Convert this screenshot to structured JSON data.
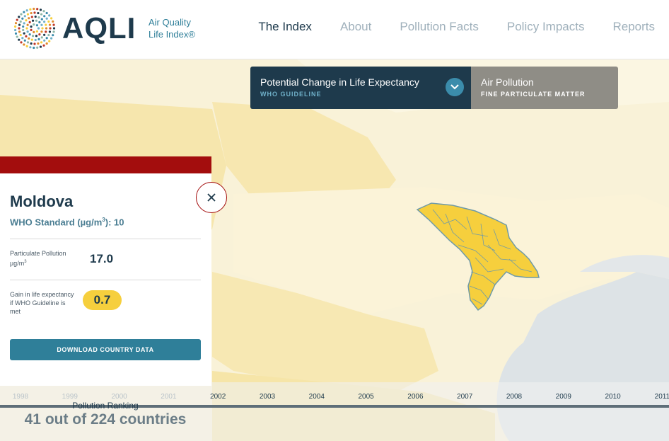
{
  "logo": {
    "name": "AQLI",
    "subtitle_line1": "Air Quality",
    "subtitle_line2": "Life Index®"
  },
  "nav": {
    "items": [
      {
        "label": "The Index",
        "active": true
      },
      {
        "label": "About",
        "active": false
      },
      {
        "label": "Pollution Facts",
        "active": false
      },
      {
        "label": "Policy Impacts",
        "active": false
      },
      {
        "label": "Reports",
        "active": false
      }
    ]
  },
  "toggle": {
    "left": {
      "title": "Potential Change in Life Expectancy",
      "subtitle": "WHO GUIDELINE"
    },
    "right": {
      "title": "Air Pollution",
      "subtitle": "FINE PARTICULATE MATTER"
    }
  },
  "country_panel": {
    "name": "Moldova",
    "who_standard_prefix": "WHO Standard (µg/m",
    "who_standard_sup": "3",
    "who_standard_suffix": "): 10",
    "pollution_label": "Particulate Pollution µg/m",
    "pollution_label_sup": "3",
    "pollution_value": "17.0",
    "gain_label": "Gain in life expectancy if WHO Guideline is met",
    "gain_value": "0.7",
    "download_label": "DOWNLOAD COUNTRY DATA"
  },
  "timeline": {
    "years": [
      "1998",
      "1999",
      "2000",
      "2001",
      "2002",
      "2003",
      "2004",
      "2005",
      "2006",
      "2007",
      "2008",
      "2009",
      "2010",
      "2011"
    ]
  },
  "ranking": {
    "label": "Pollution Ranking",
    "value": "41 out of 224 countries"
  },
  "colors": {
    "navy": "#1e3a4c",
    "teal": "#2f7f99",
    "red": "#a30d0d",
    "yellow": "#f6cf3d",
    "map_bg": "#f9f2d8"
  }
}
